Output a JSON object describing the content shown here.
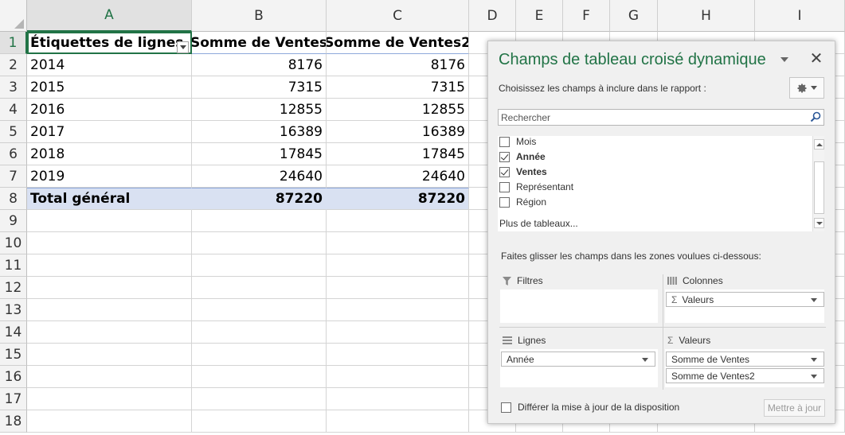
{
  "sheet": {
    "columns": [
      "A",
      "B",
      "C",
      "D",
      "E",
      "F",
      "G",
      "H",
      "I"
    ],
    "rows": [
      "1",
      "2",
      "3",
      "4",
      "5",
      "6",
      "7",
      "8",
      "9",
      "10",
      "11",
      "12",
      "13",
      "14",
      "15",
      "16",
      "17",
      "18"
    ],
    "pivot": {
      "header": [
        "Étiquettes de lignes",
        "Somme de Ventes",
        "Somme de Ventes2"
      ],
      "data": [
        [
          "2014",
          "8176",
          "8176"
        ],
        [
          "2015",
          "7315",
          "7315"
        ],
        [
          "2016",
          "12855",
          "12855"
        ],
        [
          "2017",
          "16389",
          "16389"
        ],
        [
          "2018",
          "17845",
          "17845"
        ],
        [
          "2019",
          "24640",
          "24640"
        ]
      ],
      "total": [
        "Total général",
        "87220",
        "87220"
      ]
    },
    "active_cell": "A1",
    "colors": {
      "accent": "#217346",
      "total_fill": "#d9e1f2",
      "header_border": "#8ea9db"
    }
  },
  "pane": {
    "title": "Champs de tableau croisé dynamique",
    "subtitle": "Choisissez les champs à inclure dans le rapport :",
    "gear_icon": "gear-icon",
    "search_placeholder": "Rechercher",
    "fields": [
      {
        "label": "Mois",
        "checked": false,
        "bold": false
      },
      {
        "label": "Année",
        "checked": true,
        "bold": true
      },
      {
        "label": "Ventes",
        "checked": true,
        "bold": true
      },
      {
        "label": "Représentant",
        "checked": false,
        "bold": false
      },
      {
        "label": "Région",
        "checked": false,
        "bold": false
      }
    ],
    "more_tables": "Plus de tableaux...",
    "drag_hint": "Faites glisser les champs dans les zones voulues ci-dessous:",
    "areas": {
      "filters": {
        "label": "Filtres",
        "items": []
      },
      "columns": {
        "label": "Colonnes",
        "items": [
          "Valeurs"
        ]
      },
      "rows": {
        "label": "Lignes",
        "items": [
          "Année"
        ]
      },
      "values": {
        "label": "Valeurs",
        "items": [
          "Somme de Ventes",
          "Somme de Ventes2"
        ]
      }
    },
    "sigma": "Σ",
    "defer_label": "Différer la mise à jour de la disposition",
    "defer_checked": false,
    "update_button": "Mettre à jour"
  }
}
